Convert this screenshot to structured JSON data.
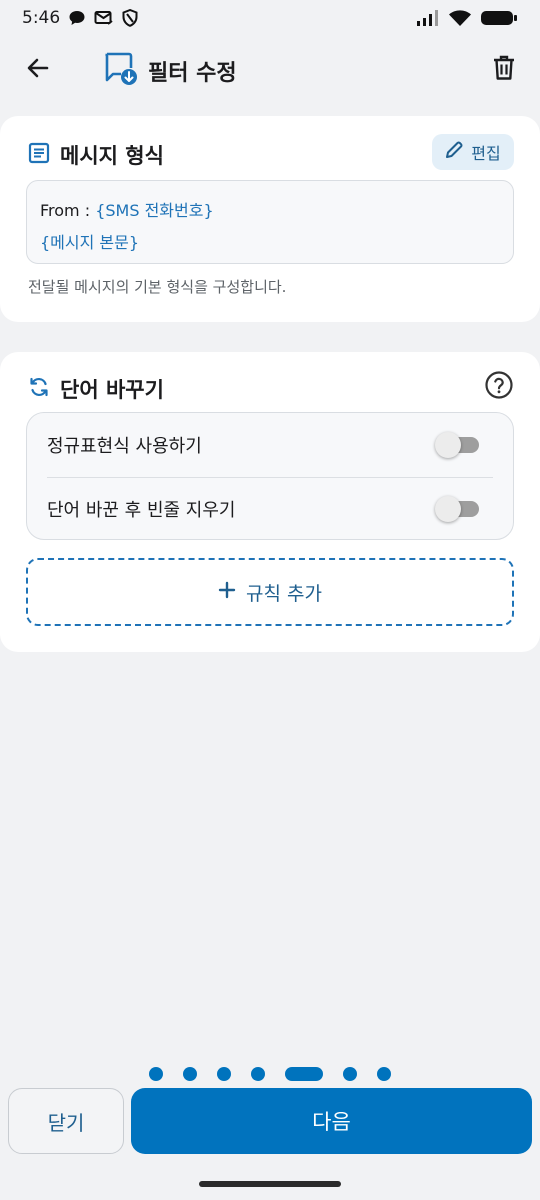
{
  "status_bar": {
    "time": "5:46",
    "left_icons": [
      "chat-bubble-icon",
      "mail-icon",
      "shield-icon"
    ],
    "right_icons": [
      "signal-icon",
      "wifi-icon",
      "battery-icon"
    ]
  },
  "app_bar": {
    "title": "필터 수정",
    "title_icon": "message-download-icon",
    "back_icon": "arrow-back-icon",
    "delete_icon": "trash-icon"
  },
  "message_format": {
    "title": "메시지 형식",
    "edit_label": "편집",
    "line1_prefix": "From : ",
    "line1_token": "{SMS 전화번호}",
    "line2_token": "{메시지 본문}",
    "description": "전달될 메시지의 기본 형식을 구성합니다."
  },
  "word_replace": {
    "title": "단어 바꾸기",
    "toggles": [
      {
        "label": "정규표현식 사용하기",
        "on": false
      },
      {
        "label": "단어 바꾼 후 빈줄 지우기",
        "on": false
      }
    ],
    "add_rule_label": "규칙 추가"
  },
  "pager": {
    "total": 7,
    "current": 5
  },
  "footer": {
    "close_label": "닫기",
    "next_label": "다음"
  },
  "colors": {
    "accent": "#0173be",
    "token": "#1f73b7",
    "background": "#f1f2f4"
  }
}
